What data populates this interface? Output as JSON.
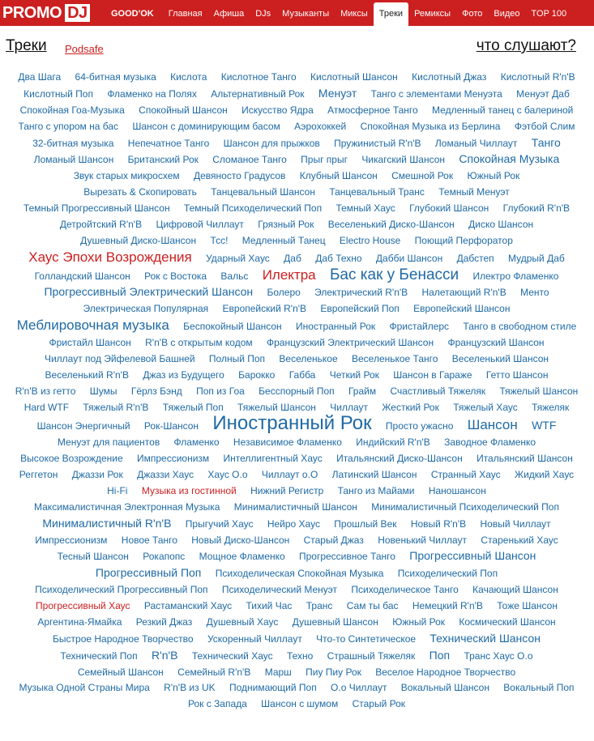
{
  "logo": {
    "promo": "PROMO",
    "dj": "DJ"
  },
  "nav": [
    "GOOD'OK",
    "Главная",
    "Афиша",
    "DJs",
    "Музыканты",
    "Миксы",
    "Треки",
    "Ремиксы",
    "Фото",
    "Видео",
    "TOP 100"
  ],
  "header": {
    "title": "Треки",
    "sub": "Podsafe",
    "right": "что слушают?"
  },
  "colors": {
    "accent": "#cc1f1f",
    "link": "#1f6aa5"
  },
  "tags": [
    {
      "t": "Два Шага",
      "s": 1
    },
    {
      "t": "64-битная музыка",
      "s": 1
    },
    {
      "t": "Кислота",
      "s": 1
    },
    {
      "t": "Кислотное Танго",
      "s": 1
    },
    {
      "t": "Кислотный Шансон",
      "s": 1
    },
    {
      "t": "Кислотный Джаз",
      "s": 1
    },
    {
      "t": "Кислотный R'n'B",
      "s": 1
    },
    {
      "t": "Кислотный Поп",
      "s": 1
    },
    {
      "t": "Фламенко на Полях",
      "s": 1
    },
    {
      "t": "Альтернативный Рок",
      "s": 1
    },
    {
      "t": "Менуэт",
      "s": 2
    },
    {
      "t": "Танго с элементами Менуэта",
      "s": 1
    },
    {
      "t": "Менуэт Даб",
      "s": 1
    },
    {
      "t": "Спокойная Гоа-Музыка",
      "s": 1
    },
    {
      "t": "Спокойный Шансон",
      "s": 1
    },
    {
      "t": "Искусство Ядра",
      "s": 1
    },
    {
      "t": "Атмосферное Танго",
      "s": 1
    },
    {
      "t": "Медленный танец с балериной",
      "s": 1
    },
    {
      "t": "Танго с упором на бас",
      "s": 1
    },
    {
      "t": "Шансон с доминирующим басом",
      "s": 1
    },
    {
      "t": "Аэрохоккей",
      "s": 1
    },
    {
      "t": "Спокойная Музыка из Берлина",
      "s": 1
    },
    {
      "t": "Фэтбой Слим",
      "s": 1
    },
    {
      "t": "32-битная музыка",
      "s": 1
    },
    {
      "t": "Непечатное Танго",
      "s": 1
    },
    {
      "t": "Шансон для прыжков",
      "s": 1
    },
    {
      "t": "Пружинистый R'n'B",
      "s": 1
    },
    {
      "t": "Ломаный Чиллаут",
      "s": 1
    },
    {
      "t": "Танго",
      "s": 2
    },
    {
      "t": "Ломаный Шансон",
      "s": 1
    },
    {
      "t": "Британский Рок",
      "s": 1
    },
    {
      "t": "Сломаное Танго",
      "s": 1
    },
    {
      "t": "Прыг прыг",
      "s": 1
    },
    {
      "t": "Чикагский Шансон",
      "s": 1
    },
    {
      "t": "Спокойная Музыка",
      "s": 2
    },
    {
      "t": "Звук старых микросхем",
      "s": 1
    },
    {
      "t": "Девяносто Градусов",
      "s": 1
    },
    {
      "t": "Клубный Шансон",
      "s": 1
    },
    {
      "t": "Смешной Рок",
      "s": 1
    },
    {
      "t": "Южный Рок",
      "s": 1
    },
    {
      "t": "Вырезать & Скопировать",
      "s": 1
    },
    {
      "t": "Танцевальный Шансон",
      "s": 1
    },
    {
      "t": "Танцевальный Транс",
      "s": 1
    },
    {
      "t": "Темный Менуэт",
      "s": 1
    },
    {
      "t": "Темный Прогрессивный Шансон",
      "s": 1
    },
    {
      "t": "Темный Психоделический Поп",
      "s": 1
    },
    {
      "t": "Темный Хаус",
      "s": 1
    },
    {
      "t": "Глубокий Шансон",
      "s": 1
    },
    {
      "t": "Глубокий R'n'B",
      "s": 1
    },
    {
      "t": "Детройтский R'n'B",
      "s": 1
    },
    {
      "t": "Цифровой Чиллаут",
      "s": 1
    },
    {
      "t": "Грязный Рок",
      "s": 1
    },
    {
      "t": "Веселенький Диско-Шансон",
      "s": 1
    },
    {
      "t": "Диско Шансон",
      "s": 1
    },
    {
      "t": "Душевный Диско-Шансон",
      "s": 1
    },
    {
      "t": "Тсс!",
      "s": 1
    },
    {
      "t": "Медленный Танец",
      "s": 1
    },
    {
      "t": "Electro House",
      "s": 1
    },
    {
      "t": "Поющий Перфоратор",
      "s": 1
    },
    {
      "t": "Хаус Эпохи Возрождения",
      "s": 3,
      "red": true
    },
    {
      "t": "Ударный Хаус",
      "s": 1
    },
    {
      "t": "Даб",
      "s": 1
    },
    {
      "t": "Даб Техно",
      "s": 1
    },
    {
      "t": "Дабби Шансон",
      "s": 1
    },
    {
      "t": "Дабстеп",
      "s": 1
    },
    {
      "t": "Мудрый Даб",
      "s": 1
    },
    {
      "t": "Голландский Шансон",
      "s": 1
    },
    {
      "t": "Рок с Востока",
      "s": 1
    },
    {
      "t": "Вальс",
      "s": 1
    },
    {
      "t": "Илектра",
      "s": 3,
      "red": true
    },
    {
      "t": "Бас как у Бенасси",
      "s": 4
    },
    {
      "t": "Илектро Фламенко",
      "s": 1
    },
    {
      "t": "Прогрессивный Электрический Шансон",
      "s": 2
    },
    {
      "t": "Болеро",
      "s": 1
    },
    {
      "t": "Электрический R'n'B",
      "s": 1
    },
    {
      "t": "Налетающий R'n'B",
      "s": 1
    },
    {
      "t": "Менто",
      "s": 1
    },
    {
      "t": "Электрическая Популярная",
      "s": 1
    },
    {
      "t": "Европейский R'n'B",
      "s": 1
    },
    {
      "t": "Европейский Поп",
      "s": 1
    },
    {
      "t": "Европейский Шансон",
      "s": 1
    },
    {
      "t": "Меблировочная музыка",
      "s": 3
    },
    {
      "t": "Беспокойный Шансон",
      "s": 1
    },
    {
      "t": "Иностранный Рок",
      "s": 1
    },
    {
      "t": "Фристайлерс",
      "s": 1
    },
    {
      "t": "Танго в свободном стиле",
      "s": 1
    },
    {
      "t": "Фристайл Шансон",
      "s": 1
    },
    {
      "t": "R'n'B с открытым кодом",
      "s": 1
    },
    {
      "t": "Французский Электрический Шансон",
      "s": 1
    },
    {
      "t": "Французский Шансон",
      "s": 1
    },
    {
      "t": "Чиллаут под Эйфелевой Башней",
      "s": 1
    },
    {
      "t": "Полный Поп",
      "s": 1
    },
    {
      "t": "Веселенькое",
      "s": 1
    },
    {
      "t": "Веселенькое Танго",
      "s": 1
    },
    {
      "t": "Веселенький Шансон",
      "s": 1
    },
    {
      "t": "Веселенький R'n'B",
      "s": 1
    },
    {
      "t": "Джаз из Будущего",
      "s": 1
    },
    {
      "t": "Барокко",
      "s": 1
    },
    {
      "t": "Габба",
      "s": 1
    },
    {
      "t": "Четкий Рок",
      "s": 1
    },
    {
      "t": "Шансон в Гараже",
      "s": 1
    },
    {
      "t": "Гетто Шансон",
      "s": 1
    },
    {
      "t": "R'n'B из гетто",
      "s": 1
    },
    {
      "t": "Шумы",
      "s": 1
    },
    {
      "t": "Гёрлз Бэнд",
      "s": 1
    },
    {
      "t": "Поп из Гоа",
      "s": 1
    },
    {
      "t": "Бесспорный Поп",
      "s": 1
    },
    {
      "t": "Грайм",
      "s": 1
    },
    {
      "t": "Счастливый Тяжеляк",
      "s": 1
    },
    {
      "t": "Тяжелый Шансон",
      "s": 1
    },
    {
      "t": "Hard WTF",
      "s": 1
    },
    {
      "t": "Тяжелый R'n'B",
      "s": 1
    },
    {
      "t": "Тяжелый Поп",
      "s": 1
    },
    {
      "t": "Тяжелый Шансон",
      "s": 1
    },
    {
      "t": "Чиллаут",
      "s": 1
    },
    {
      "t": "Жесткий Рок",
      "s": 1
    },
    {
      "t": "Тяжелый Хаус",
      "s": 1
    },
    {
      "t": "Тяжеляк",
      "s": 1
    },
    {
      "t": "Шансон Энергичный",
      "s": 1
    },
    {
      "t": "Рок-Шансон",
      "s": 1
    },
    {
      "t": "Иностранный Рок",
      "s": 5
    },
    {
      "t": "Просто ужасно",
      "s": 1
    },
    {
      "t": "Шансон",
      "s": 3
    },
    {
      "t": "WTF",
      "s": 2
    },
    {
      "t": "Менуэт для пациентов",
      "s": 1
    },
    {
      "t": "Фламенко",
      "s": 1
    },
    {
      "t": "Независимое Фламенко",
      "s": 1
    },
    {
      "t": "Индийский R'n'B",
      "s": 1
    },
    {
      "t": "Заводное Фламенко",
      "s": 1
    },
    {
      "t": "Высокое Возрождение",
      "s": 1
    },
    {
      "t": "Импрессионизм",
      "s": 1
    },
    {
      "t": "Интеллигентный Хаус",
      "s": 1
    },
    {
      "t": "Итальянский Диско-Шансон",
      "s": 1
    },
    {
      "t": "Итальянский Шансон",
      "s": 1
    },
    {
      "t": "Реггетон",
      "s": 1
    },
    {
      "t": "Джаззи Рок",
      "s": 1
    },
    {
      "t": "Джаззи Хаус",
      "s": 1
    },
    {
      "t": "Хаус О.о",
      "s": 1
    },
    {
      "t": "Чиллаут о.О",
      "s": 1
    },
    {
      "t": "Латинский Шансон",
      "s": 1
    },
    {
      "t": "Странный Хаус",
      "s": 1
    },
    {
      "t": "Жидкий Хаус",
      "s": 1
    },
    {
      "t": "Hi-Fi",
      "s": 1
    },
    {
      "t": "Музыка из гостинной",
      "s": 1,
      "red": true
    },
    {
      "t": "Нижний Регистр",
      "s": 1
    },
    {
      "t": "Танго из Майами",
      "s": 1
    },
    {
      "t": "Наношансон",
      "s": 1
    },
    {
      "t": "Максималистичная Электронная Музыка",
      "s": 1
    },
    {
      "t": "Минималистичный Шансон",
      "s": 1
    },
    {
      "t": "Минималистичный Психоделический Поп",
      "s": 1
    },
    {
      "t": "Минималистичный R'n'B",
      "s": 2
    },
    {
      "t": "Прыгучий Хаус",
      "s": 1
    },
    {
      "t": "Нейро Хаус",
      "s": 1
    },
    {
      "t": "Прошлый Век",
      "s": 1
    },
    {
      "t": "Новый R'n'B",
      "s": 1
    },
    {
      "t": "Новый Чиллаут",
      "s": 1
    },
    {
      "t": "Импрессионизм",
      "s": 1
    },
    {
      "t": "Новое Танго",
      "s": 1
    },
    {
      "t": "Новый Диско-Шансон",
      "s": 1
    },
    {
      "t": "Старый Джаз",
      "s": 1
    },
    {
      "t": "Новенький Чиллаут",
      "s": 1
    },
    {
      "t": "Старенький Хаус",
      "s": 1
    },
    {
      "t": "Тесный Шансон",
      "s": 1
    },
    {
      "t": "Рокапопс",
      "s": 1
    },
    {
      "t": "Мощное Фламенко",
      "s": 1
    },
    {
      "t": "Прогрессивное Танго",
      "s": 1
    },
    {
      "t": "Прогрессивный Шансон",
      "s": 2
    },
    {
      "t": "Прогрессивный Поп",
      "s": 2
    },
    {
      "t": "Психоделическая Спокойная Музыка",
      "s": 1
    },
    {
      "t": "Психоделический Поп",
      "s": 1
    },
    {
      "t": "Психоделический Прогрессивный Поп",
      "s": 1
    },
    {
      "t": "Психоделический Менуэт",
      "s": 1
    },
    {
      "t": "Психоделическое Танго",
      "s": 1
    },
    {
      "t": "Качающий Шансон",
      "s": 1
    },
    {
      "t": "Прогрессивный Хаус",
      "s": 1,
      "red": true
    },
    {
      "t": "Растаманский Хаус",
      "s": 1
    },
    {
      "t": "Тихий Час",
      "s": 1
    },
    {
      "t": "Транс",
      "s": 1
    },
    {
      "t": "Сам ты бас",
      "s": 1
    },
    {
      "t": "Немецкий R'n'B",
      "s": 1
    },
    {
      "t": "Тоже Шансон",
      "s": 1
    },
    {
      "t": "Аргентина-Ямайка",
      "s": 1
    },
    {
      "t": "Резкий Джаз",
      "s": 1
    },
    {
      "t": "Душевный Хаус",
      "s": 1
    },
    {
      "t": "Душевный Шансон",
      "s": 1
    },
    {
      "t": "Южный Рок",
      "s": 1
    },
    {
      "t": "Космический Шансон",
      "s": 1
    },
    {
      "t": "Быстрое Народное Творчество",
      "s": 1
    },
    {
      "t": "Ускоренный Чиллаут",
      "s": 1
    },
    {
      "t": "Что-то Синтетическое",
      "s": 1
    },
    {
      "t": "Технический Шансон",
      "s": 2
    },
    {
      "t": "Технический Поп",
      "s": 1
    },
    {
      "t": "R'n'B",
      "s": 2
    },
    {
      "t": "Технический Хаус",
      "s": 1
    },
    {
      "t": "Техно",
      "s": 1
    },
    {
      "t": "Страшный Тяжеляк",
      "s": 1
    },
    {
      "t": "Поп",
      "s": 2
    },
    {
      "t": "Транс Хаус О.о",
      "s": 1
    },
    {
      "t": "Семейный Шансон",
      "s": 1
    },
    {
      "t": "Семейный R'n'B",
      "s": 1
    },
    {
      "t": "Марш",
      "s": 1
    },
    {
      "t": "Пиу Пиу Рок",
      "s": 1
    },
    {
      "t": "Веселое Народное Творчество",
      "s": 1
    },
    {
      "t": "Музыка Одной Страны Мира",
      "s": 1
    },
    {
      "t": "R'n'B из UK",
      "s": 1
    },
    {
      "t": "Поднимающий Поп",
      "s": 1
    },
    {
      "t": "О.о Чиллаут",
      "s": 1
    },
    {
      "t": "Вокальный Шансон",
      "s": 1
    },
    {
      "t": "Вокальный Поп",
      "s": 1
    },
    {
      "t": "Рок с Запада",
      "s": 1
    },
    {
      "t": "Шансон с шумом",
      "s": 1
    },
    {
      "t": "Старый Рок",
      "s": 1
    }
  ]
}
